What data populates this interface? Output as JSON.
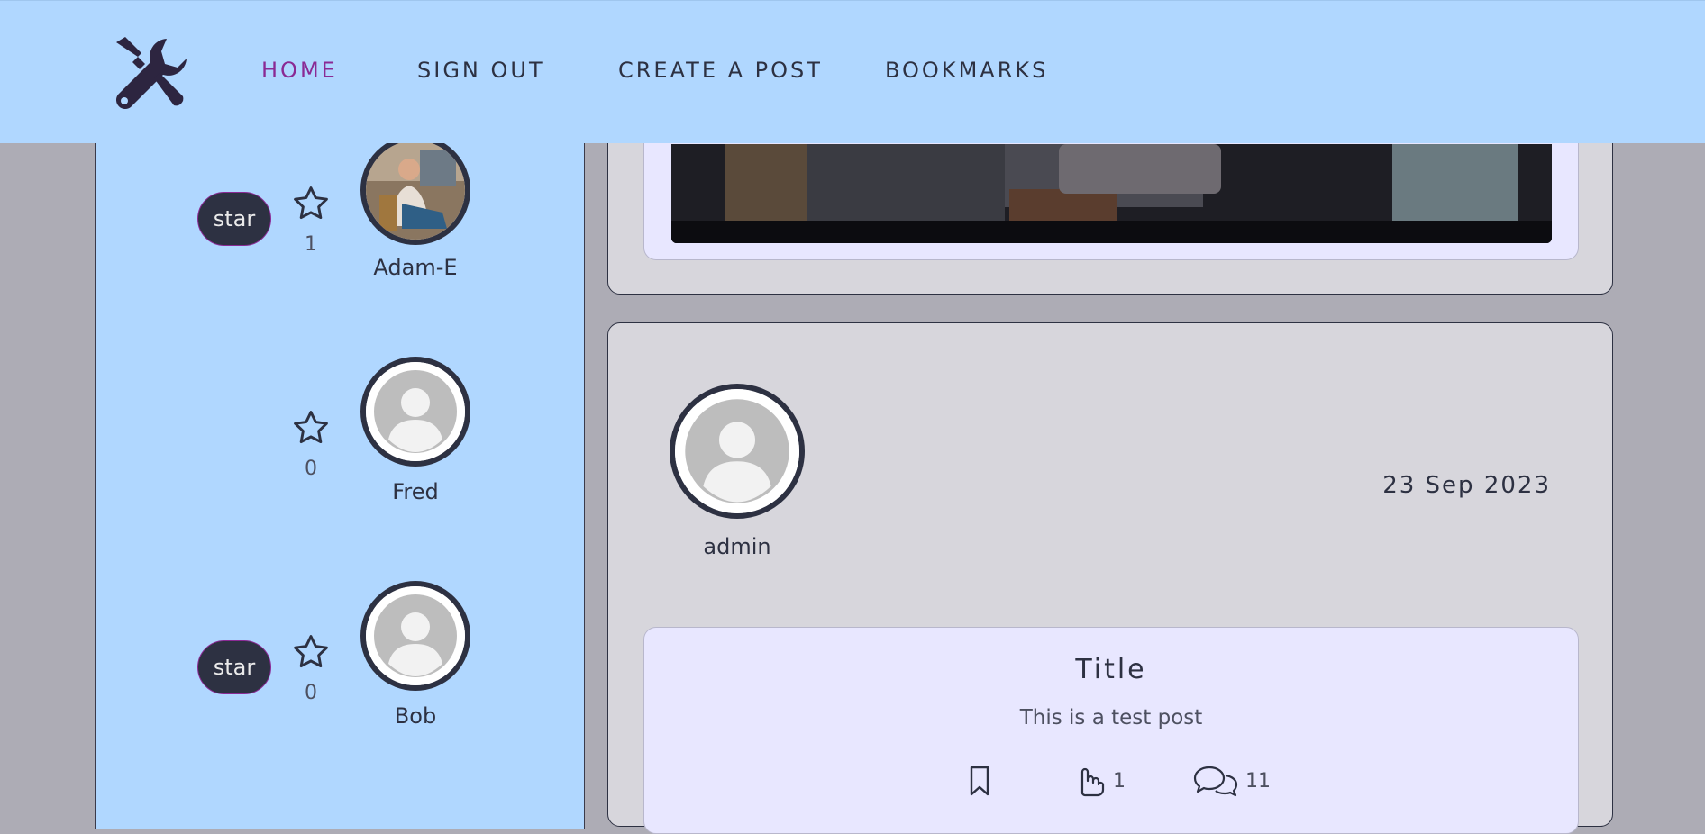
{
  "navbar": {
    "logo": "tools-logo-icon",
    "links": [
      {
        "label": "HOME",
        "active": true
      },
      {
        "label": "SIGN OUT",
        "active": false
      },
      {
        "label": "CREATE A POST",
        "active": false
      },
      {
        "label": "BOOKMARKS",
        "active": false
      }
    ]
  },
  "sidebar": {
    "profiles": [
      {
        "username": "Adam-E",
        "star_label": "star",
        "star_count": "1",
        "has_star_button": true,
        "avatar": "photo"
      },
      {
        "username": "Fred",
        "star_label": "",
        "star_count": "0",
        "has_star_button": false,
        "avatar": "default"
      },
      {
        "username": "Bob",
        "star_label": "star",
        "star_count": "0",
        "has_star_button": true,
        "avatar": "default"
      }
    ]
  },
  "posts": [
    {
      "image": "dark-workshop-photo"
    },
    {
      "author": "admin",
      "date": "23 Sep 2023",
      "title": "Title",
      "body": "This is a test post",
      "likes": "1",
      "comments": "11"
    }
  ],
  "colors": {
    "navbar_bg": "#b0d7ff",
    "page_bg": "#adacb5",
    "accent": "#8a2a94",
    "dark": "#2d3142",
    "card_bg": "#d7d6dc",
    "inner_card_bg": "#e8e7ff"
  }
}
